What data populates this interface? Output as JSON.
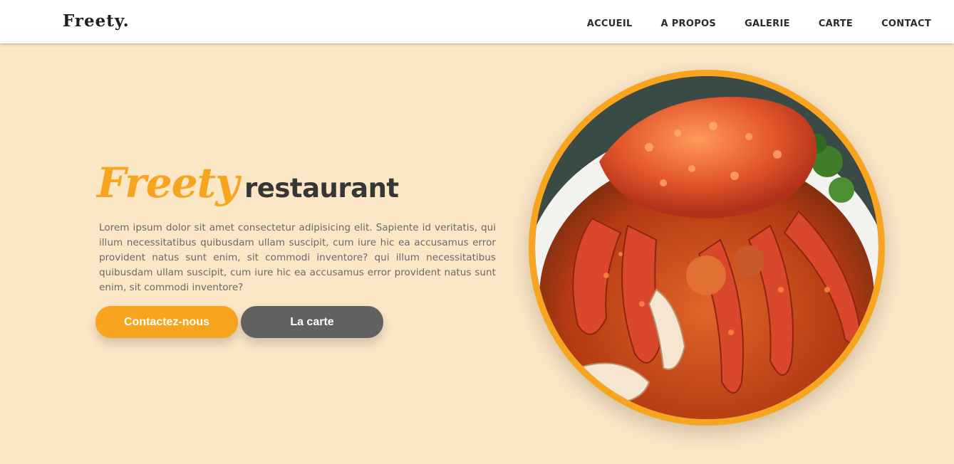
{
  "header": {
    "logo": "Freety.",
    "nav": [
      "ACCUEIL",
      "A PROPOS",
      "GALERIE",
      "CARTE",
      "CONTACT"
    ]
  },
  "hero": {
    "brand": "Freety",
    "title_rest": "restaurant",
    "description": "Lorem ipsum dolor sit amet consectetur adipisicing elit. Sapiente id veritatis, qui illum necessitatibus quibusdam ullam suscipit, cum iure hic ea accusamus error provident natus sunt enim, sit commodi inventore? qui illum necessitatibus quibusdam ullam suscipit, cum iure hic ea accusamus error provident natus sunt enim, sit commodi inventore?",
    "buttons": {
      "contact": "Contactez-nous",
      "menu": "La carte"
    },
    "image_subject": "crab-dish-photo"
  },
  "colors": {
    "accent": "#f7a51e",
    "hero_background": "#fbe6c6",
    "heading_dark": "#363636",
    "button_secondary": "#616161"
  }
}
